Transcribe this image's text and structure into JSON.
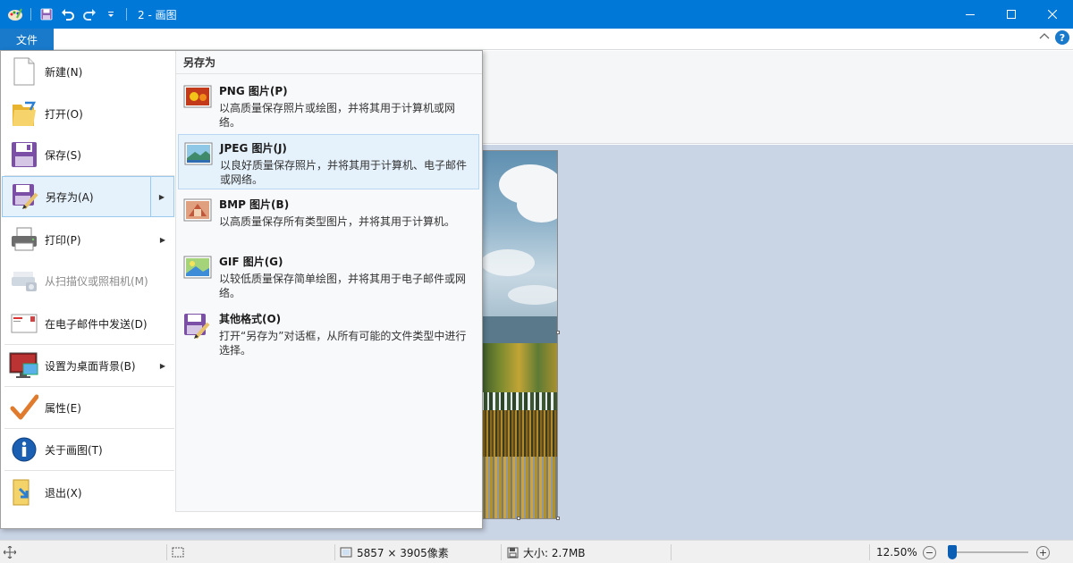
{
  "window": {
    "title": "2 - 画图"
  },
  "ribbon": {
    "file_tab": "文件"
  },
  "file_menu": {
    "items": [
      {
        "label": "新建(N)",
        "icon": "new-document-icon"
      },
      {
        "label": "打开(O)",
        "icon": "open-folder-icon"
      },
      {
        "label": "保存(S)",
        "icon": "save-icon"
      },
      {
        "label": "另存为(A)",
        "icon": "save-as-icon",
        "selected": true,
        "submenu": true
      },
      {
        "label": "打印(P)",
        "icon": "printer-icon",
        "submenu": true
      },
      {
        "label": "从扫描仪或照相机(M)",
        "icon": "scanner-icon",
        "disabled": true
      },
      {
        "label": "在电子邮件中发送(D)",
        "icon": "email-icon"
      },
      {
        "label": "设置为桌面背景(B)",
        "icon": "desktop-background-icon",
        "submenu": true
      },
      {
        "label": "属性(E)",
        "icon": "properties-checkmark-icon"
      },
      {
        "label": "关于画图(T)",
        "icon": "info-icon"
      },
      {
        "label": "退出(X)",
        "icon": "exit-icon"
      }
    ]
  },
  "save_as_submenu": {
    "header": "另存为",
    "items": [
      {
        "title": "PNG 图片(P)",
        "desc": "以高质量保存照片或绘图，并将其用于计算机或网络。",
        "icon": "png-image-icon"
      },
      {
        "title": "JPEG 图片(J)",
        "desc": "以良好质量保存照片，并将其用于计算机、电子邮件或网络。",
        "icon": "jpeg-image-icon",
        "selected": true
      },
      {
        "title": "BMP 图片(B)",
        "desc": "以高质量保存所有类型图片，并将其用于计算机。",
        "icon": "bmp-image-icon"
      },
      {
        "title": "GIF 图片(G)",
        "desc": "以较低质量保存简单绘图，并将其用于电子邮件或网络。",
        "icon": "gif-image-icon"
      },
      {
        "title": "其他格式(O)",
        "desc": "打开“另存为”对话框，从所有可能的文件类型中进行选择。",
        "icon": "other-formats-icon"
      }
    ]
  },
  "status_bar": {
    "dimensions": "5857 × 3905像素",
    "size": "大小: 2.7MB",
    "zoom": "12.50%",
    "zoom_level_percent": 12.5
  },
  "colors": {
    "title_bar": "#0078d7",
    "file_tab": "#1979ca",
    "canvas_bg": "#c9d4e5",
    "selection": "#e5f1fb"
  }
}
